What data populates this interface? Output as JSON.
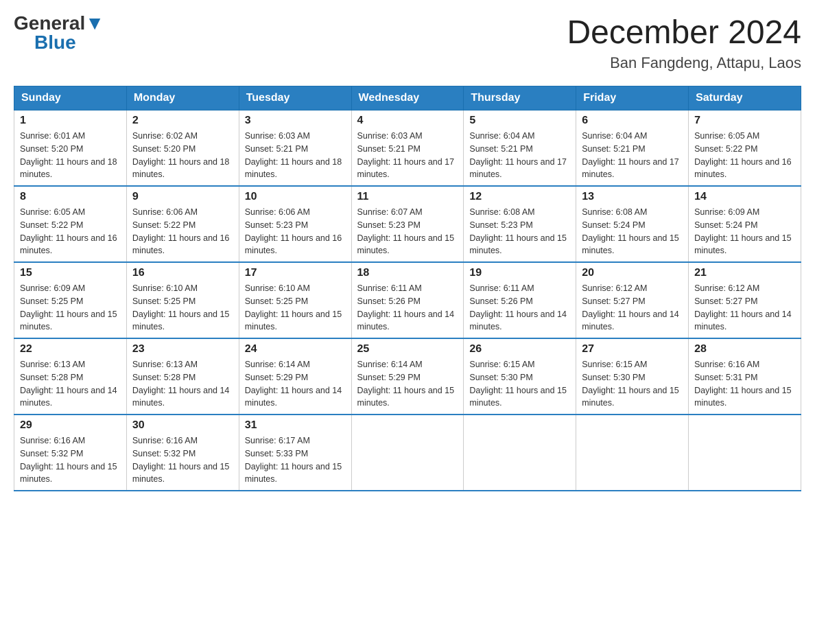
{
  "header": {
    "logo_general": "General",
    "logo_blue": "Blue",
    "title": "December 2024",
    "location": "Ban Fangdeng, Attapu, Laos"
  },
  "weekdays": [
    "Sunday",
    "Monday",
    "Tuesday",
    "Wednesday",
    "Thursday",
    "Friday",
    "Saturday"
  ],
  "weeks": [
    [
      {
        "day": "1",
        "sunrise": "6:01 AM",
        "sunset": "5:20 PM",
        "daylight": "11 hours and 18 minutes."
      },
      {
        "day": "2",
        "sunrise": "6:02 AM",
        "sunset": "5:20 PM",
        "daylight": "11 hours and 18 minutes."
      },
      {
        "day": "3",
        "sunrise": "6:03 AM",
        "sunset": "5:21 PM",
        "daylight": "11 hours and 18 minutes."
      },
      {
        "day": "4",
        "sunrise": "6:03 AM",
        "sunset": "5:21 PM",
        "daylight": "11 hours and 17 minutes."
      },
      {
        "day": "5",
        "sunrise": "6:04 AM",
        "sunset": "5:21 PM",
        "daylight": "11 hours and 17 minutes."
      },
      {
        "day": "6",
        "sunrise": "6:04 AM",
        "sunset": "5:21 PM",
        "daylight": "11 hours and 17 minutes."
      },
      {
        "day": "7",
        "sunrise": "6:05 AM",
        "sunset": "5:22 PM",
        "daylight": "11 hours and 16 minutes."
      }
    ],
    [
      {
        "day": "8",
        "sunrise": "6:05 AM",
        "sunset": "5:22 PM",
        "daylight": "11 hours and 16 minutes."
      },
      {
        "day": "9",
        "sunrise": "6:06 AM",
        "sunset": "5:22 PM",
        "daylight": "11 hours and 16 minutes."
      },
      {
        "day": "10",
        "sunrise": "6:06 AM",
        "sunset": "5:23 PM",
        "daylight": "11 hours and 16 minutes."
      },
      {
        "day": "11",
        "sunrise": "6:07 AM",
        "sunset": "5:23 PM",
        "daylight": "11 hours and 15 minutes."
      },
      {
        "day": "12",
        "sunrise": "6:08 AM",
        "sunset": "5:23 PM",
        "daylight": "11 hours and 15 minutes."
      },
      {
        "day": "13",
        "sunrise": "6:08 AM",
        "sunset": "5:24 PM",
        "daylight": "11 hours and 15 minutes."
      },
      {
        "day": "14",
        "sunrise": "6:09 AM",
        "sunset": "5:24 PM",
        "daylight": "11 hours and 15 minutes."
      }
    ],
    [
      {
        "day": "15",
        "sunrise": "6:09 AM",
        "sunset": "5:25 PM",
        "daylight": "11 hours and 15 minutes."
      },
      {
        "day": "16",
        "sunrise": "6:10 AM",
        "sunset": "5:25 PM",
        "daylight": "11 hours and 15 minutes."
      },
      {
        "day": "17",
        "sunrise": "6:10 AM",
        "sunset": "5:25 PM",
        "daylight": "11 hours and 15 minutes."
      },
      {
        "day": "18",
        "sunrise": "6:11 AM",
        "sunset": "5:26 PM",
        "daylight": "11 hours and 14 minutes."
      },
      {
        "day": "19",
        "sunrise": "6:11 AM",
        "sunset": "5:26 PM",
        "daylight": "11 hours and 14 minutes."
      },
      {
        "day": "20",
        "sunrise": "6:12 AM",
        "sunset": "5:27 PM",
        "daylight": "11 hours and 14 minutes."
      },
      {
        "day": "21",
        "sunrise": "6:12 AM",
        "sunset": "5:27 PM",
        "daylight": "11 hours and 14 minutes."
      }
    ],
    [
      {
        "day": "22",
        "sunrise": "6:13 AM",
        "sunset": "5:28 PM",
        "daylight": "11 hours and 14 minutes."
      },
      {
        "day": "23",
        "sunrise": "6:13 AM",
        "sunset": "5:28 PM",
        "daylight": "11 hours and 14 minutes."
      },
      {
        "day": "24",
        "sunrise": "6:14 AM",
        "sunset": "5:29 PM",
        "daylight": "11 hours and 14 minutes."
      },
      {
        "day": "25",
        "sunrise": "6:14 AM",
        "sunset": "5:29 PM",
        "daylight": "11 hours and 15 minutes."
      },
      {
        "day": "26",
        "sunrise": "6:15 AM",
        "sunset": "5:30 PM",
        "daylight": "11 hours and 15 minutes."
      },
      {
        "day": "27",
        "sunrise": "6:15 AM",
        "sunset": "5:30 PM",
        "daylight": "11 hours and 15 minutes."
      },
      {
        "day": "28",
        "sunrise": "6:16 AM",
        "sunset": "5:31 PM",
        "daylight": "11 hours and 15 minutes."
      }
    ],
    [
      {
        "day": "29",
        "sunrise": "6:16 AM",
        "sunset": "5:32 PM",
        "daylight": "11 hours and 15 minutes."
      },
      {
        "day": "30",
        "sunrise": "6:16 AM",
        "sunset": "5:32 PM",
        "daylight": "11 hours and 15 minutes."
      },
      {
        "day": "31",
        "sunrise": "6:17 AM",
        "sunset": "5:33 PM",
        "daylight": "11 hours and 15 minutes."
      },
      null,
      null,
      null,
      null
    ]
  ]
}
